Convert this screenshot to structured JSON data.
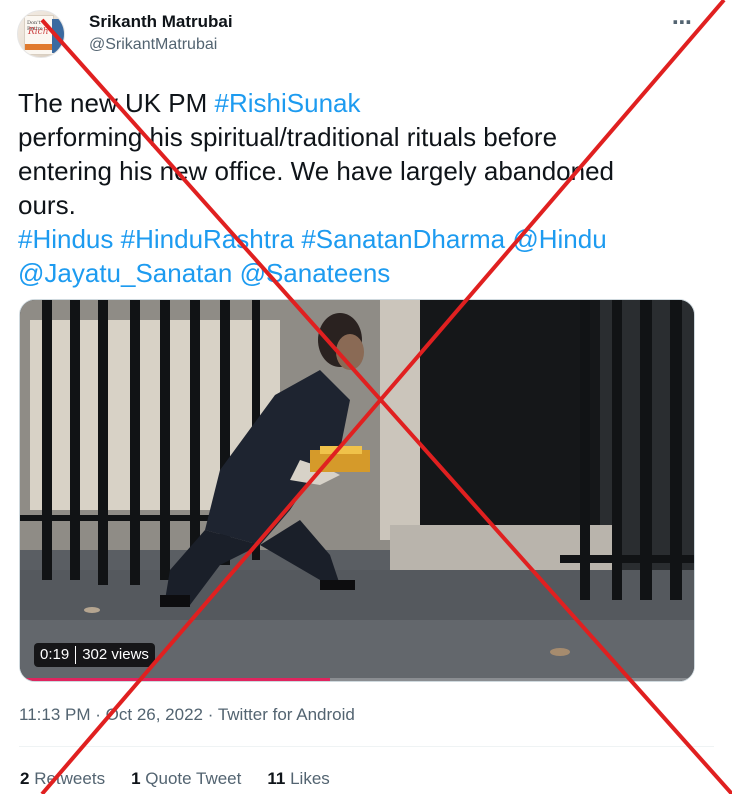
{
  "author": {
    "name": "Srikanth Matrubai",
    "handle": "@SrikantMatrubai",
    "avatar_text_top": "Don't Retire",
    "avatar_text_main": "Rich"
  },
  "more_icon": "⋯",
  "tweet": {
    "line1_text": "The new UK PM ",
    "line1_tag": "#RishiSunak",
    "line2": "performing his spiritual/traditional rituals before",
    "line3": "entering his new office. We have largely abandoned",
    "line4": "ours.",
    "tags_line1": [
      "#Hindus",
      "#HinduRashtra",
      "#SanatanDharma",
      "@Hindu"
    ],
    "tags_line2": [
      "@Jayatu_Sanatan",
      "@Sanateens"
    ]
  },
  "video": {
    "duration": "0:19",
    "views": "302 views",
    "progress": 0.46
  },
  "meta": {
    "time": "11:13 PM",
    "separator": "·",
    "date": "Oct 26, 2022",
    "source": "Twitter for Android"
  },
  "stats": {
    "retweets_count": "2",
    "retweets_label": "Retweets",
    "quotes_count": "1",
    "quotes_label": "Quote Tweet",
    "likes_count": "11",
    "likes_label": "Likes"
  },
  "colors": {
    "link": "#1d9bf0",
    "cross": "#e02020",
    "muted": "#536471"
  }
}
